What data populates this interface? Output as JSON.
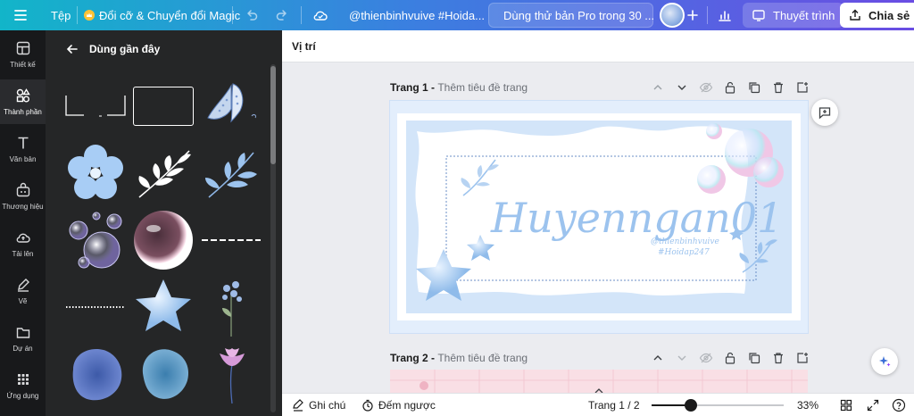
{
  "topbar": {
    "file_label": "Tệp",
    "magic_label": "Đổi cỡ & Chuyển đổi Magic",
    "doc_title": "@thienbinhvuive #Hoida...",
    "pro_trial_label": "Dùng thử bản Pro trong 30 ...",
    "present_label": "Thuyết trình",
    "share_label": "Chia sẻ"
  },
  "rail": {
    "items": [
      {
        "label": "Thiết kế",
        "icon": "design-icon"
      },
      {
        "label": "Thành phần",
        "icon": "elements-icon"
      },
      {
        "label": "Văn bản",
        "icon": "text-icon"
      },
      {
        "label": "Thương hiệu",
        "icon": "brand-icon"
      },
      {
        "label": "Tải lên",
        "icon": "upload-icon"
      },
      {
        "label": "Vẽ",
        "icon": "draw-icon"
      },
      {
        "label": "Dự án",
        "icon": "projects-icon"
      },
      {
        "label": "Ứng dụng",
        "icon": "apps-icon"
      }
    ]
  },
  "panel": {
    "title": "Dùng gần đây"
  },
  "toolbar": {
    "position_label": "Vị trí"
  },
  "pages": [
    {
      "label": "Trang 1 - ",
      "placeholder": "Thêm tiêu đề trang"
    },
    {
      "label": "Trang 2 - ",
      "placeholder": "Thêm tiêu đề trang"
    }
  ],
  "design": {
    "headline": "Huyenngan01",
    "handle": "@thienbinhvuive",
    "hashtag": "#Hoidap247"
  },
  "bottombar": {
    "notes_label": "Ghi chú",
    "timer_label": "Đếm ngược",
    "page_indicator": "Trang 1 / 2",
    "zoom_label": "33%",
    "zoom_fraction": 0.33
  },
  "colors": {
    "accent": "#8b3dff",
    "topbar_start": "#12b5c9",
    "topbar_end": "#6a4de3",
    "panel_bg": "#252627",
    "design_blue": "#9cc3ee"
  }
}
